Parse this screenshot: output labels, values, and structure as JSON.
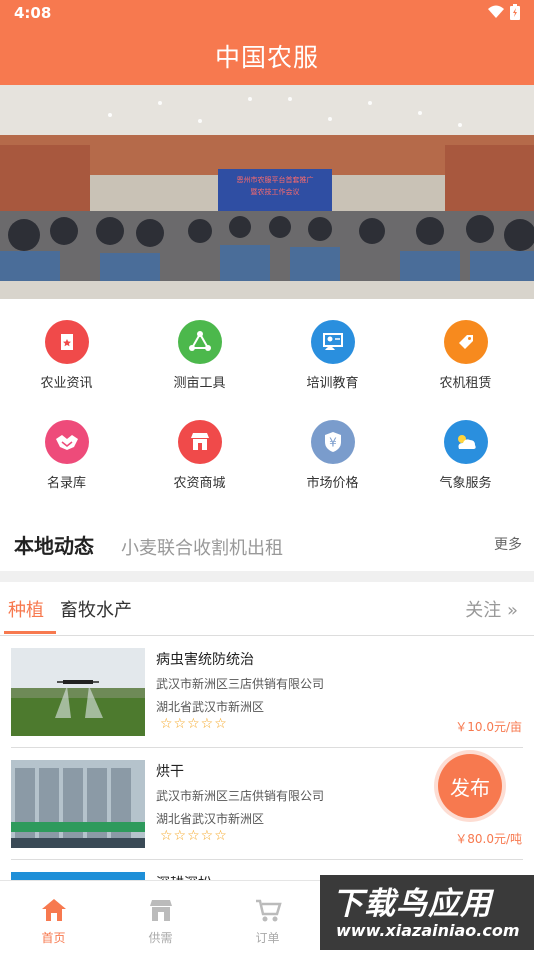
{
  "status": {
    "time": "4:08"
  },
  "header": {
    "title": "中国农服"
  },
  "banner": {
    "screen_text_1": "恩州市农服平台首套推广",
    "screen_text_2": "暨农技工作会议"
  },
  "grid": [
    {
      "label": "农业资讯",
      "icon": "news-bookmark-icon",
      "color": "#f04a4a"
    },
    {
      "label": "测亩工具",
      "icon": "measure-icon",
      "color": "#4cb84c"
    },
    {
      "label": "培训教育",
      "icon": "training-icon",
      "color": "#2a8fde"
    },
    {
      "label": "农机租赁",
      "icon": "rental-tag-icon",
      "color": "#f78a1e"
    },
    {
      "label": "名录库",
      "icon": "handshake-icon",
      "color": "#ee4b7a"
    },
    {
      "label": "农资商城",
      "icon": "shop-icon",
      "color": "#f04a4a"
    },
    {
      "label": "市场价格",
      "icon": "yuan-shield-icon",
      "color": "#7a9ccc"
    },
    {
      "label": "气象服务",
      "icon": "weather-icon",
      "color": "#2a8fde"
    }
  ],
  "local": {
    "title": "本地动态",
    "text": "小麦联合收割机出租",
    "more": "更多"
  },
  "tabs": {
    "plant": "种植",
    "livestock": "畜牧水产",
    "follow": "关注 »"
  },
  "products": [
    {
      "title": "病虫害统防统治",
      "company": "武汉市新洲区三店供销有限公司",
      "location": "湖北省武汉市新洲区",
      "stars": "☆☆☆☆☆",
      "price": "￥10.0元/亩"
    },
    {
      "title": "烘干",
      "company": "武汉市新洲区三店供销有限公司",
      "location": "湖北省武汉市新洲区",
      "stars": "☆☆☆☆☆",
      "price": "￥80.0元/吨"
    },
    {
      "title": "深耕深松",
      "company": "",
      "location": "",
      "stars": "",
      "price": ""
    }
  ],
  "publish": {
    "label": "发布"
  },
  "nav": [
    {
      "label": "首页",
      "icon": "home-icon"
    },
    {
      "label": "供需",
      "icon": "store-icon"
    },
    {
      "label": "订单",
      "icon": "cart-icon"
    }
  ],
  "watermark": {
    "title": "下载鸟应用",
    "url": "www.xiazainiao.com"
  }
}
